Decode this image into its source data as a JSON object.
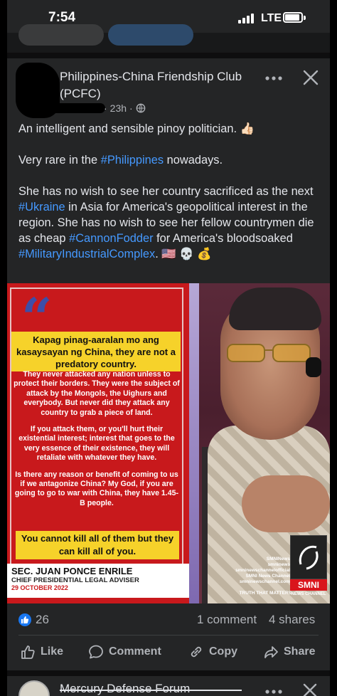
{
  "status_bar": {
    "time": "7:54",
    "network": "LTE",
    "signal_icon": "signal-bars-icon",
    "battery_icon": "battery-icon"
  },
  "post": {
    "page_name": "Philippines-China Friendship Club (PCFC)",
    "time_ago": "23h",
    "visibility_icon": "globe-icon",
    "paragraphs": [
      {
        "segments": [
          {
            "text": "An intelligent and sensible pinoy politician. 👍🏻",
            "tag": false
          }
        ]
      },
      {
        "segments": [
          {
            "text": "Very rare in the ",
            "tag": false
          },
          {
            "text": "#Philippines",
            "tag": true
          },
          {
            "text": " nowadays.",
            "tag": false
          }
        ]
      },
      {
        "segments": [
          {
            "text": "She has no wish to see her country sacrificed as the next ",
            "tag": false
          },
          {
            "text": "#Ukraine",
            "tag": true
          },
          {
            "text": " in Asia for America's geopolitical interest in the region. She has no wish to see her fellow countrymen die as cheap ",
            "tag": false
          },
          {
            "text": "#CannonFodder",
            "tag": true
          },
          {
            "text": " for America's bloodsoaked ",
            "tag": false
          },
          {
            "text": "#MilitaryIndustrialComplex",
            "tag": true
          },
          {
            "text": ". 🇺🇸 💀 💰",
            "tag": false
          }
        ]
      }
    ],
    "image": {
      "quote_mark": "“",
      "headline": "Kapag pinag-aaralan mo ang kasaysayan ng China, they are not a predatory country.",
      "body": [
        "They never attacked any nation unless to protect their borders. They were the subject of attack by the Mongols, the Uighurs and everybody. But never did they attack any country to grab a piece of land.",
        "If you attack them, or you'll hurt their existential interest; interest that goes to the very essence of their existence, they will retaliate with whatever they have.",
        "Is there any reason or benefit of coming to us if we antagonize China? My God, if you are going to go to war with China, they have 1.45-B people."
      ],
      "closing": "You cannot kill all of them but they can kill all of you.",
      "speaker_name": "SEC. JUAN PONCE ENRILE",
      "speaker_title": "CHIEF PRESIDENTIAL LEGAL ADVISER",
      "speaker_date": "29 OCTOBER 2022",
      "social_handles": [
        "SMNINews",
        "smninews",
        "smninewschannelofficial",
        "SMNI News Channel",
        "smninewschannel.com"
      ],
      "tagline": "TRUTH THAT MATTERS",
      "brand": "SMNI",
      "brand_sub": "NEWS CHANNEL"
    },
    "reactions": {
      "count": "26",
      "comments": "1 comment",
      "shares": "4 shares"
    },
    "actions": {
      "like": "Like",
      "comment": "Comment",
      "copy": "Copy",
      "share": "Share"
    }
  },
  "next_post": {
    "page_name": "Mercury Defense Forum"
  },
  "colors": {
    "background": "#18191a",
    "card": "#242526",
    "hashtag": "#4599ff",
    "like_blue": "#1877f2",
    "muted_text": "#b0b3b8"
  }
}
